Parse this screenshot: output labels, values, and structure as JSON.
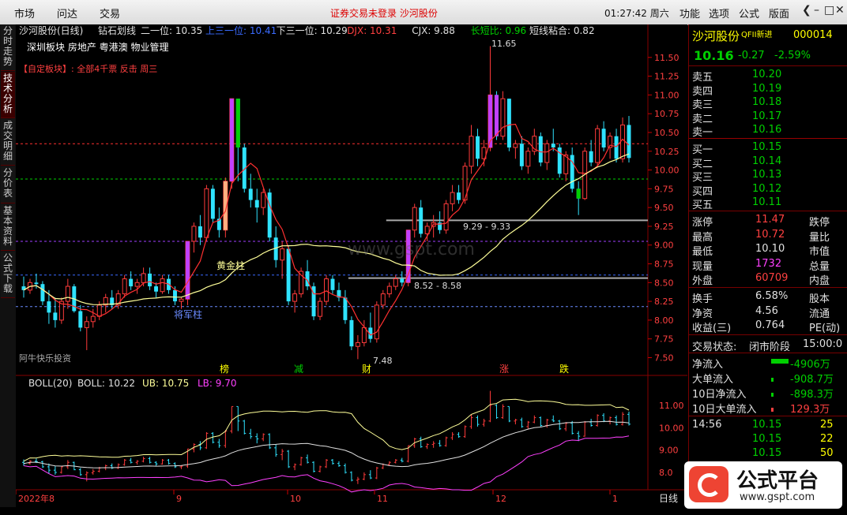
{
  "topbar": {
    "menus": [
      "市场",
      "问达",
      "交易"
    ],
    "notice": "证券交易未登录  沙河股份",
    "clock": "01:27:42 周六",
    "tools": [
      "功能",
      "选项",
      "公式",
      "版面"
    ],
    "win": [
      "❮",
      "–",
      "□",
      "✕"
    ]
  },
  "lefttabs": [
    "分时走势",
    "技术分析",
    "成交明细",
    "分价表",
    "基本资料",
    "公式下载"
  ],
  "chart": {
    "title": "沙河股份(日线)",
    "indicator": "钻石划线",
    "lines": [
      {
        "label": "二一位: 10.35",
        "color": "#e0e0e0"
      },
      {
        "label": "上三一位: 10.41",
        "color": "#3a6bff"
      },
      {
        "label": "下三一位: 10.29",
        "color": "#e0e0e0"
      },
      {
        "label": "DJX: 10.31",
        "color": "#ff4040"
      },
      {
        "label": "CJX: 9.88",
        "color": "#e0e0e0"
      },
      {
        "label": "长短比: 0.96",
        "color": "#00d000"
      },
      {
        "label": "短线粘合: 0.82",
        "color": "#e0e0e0"
      }
    ],
    "sector": "深圳板块 房地产 粤港澳 物业管理",
    "custom": "【自定板块】: 全部4千票 反击 周三",
    "watermark": "www.gspt.com",
    "annotations": {
      "high": "11.65",
      "low": "7.48",
      "gold": "黄金柱",
      "general": "将军柱",
      "range": "9.29 - 9.33",
      "level": "8.52 - 8.58",
      "footer": "阿牛快乐投资",
      "tags": [
        "榜",
        "减",
        "财",
        "涨",
        "跌"
      ]
    },
    "y_ticks": [
      "11.50",
      "11.25",
      "11.00",
      "10.75",
      "10.50",
      "10.25",
      "10.00",
      "9.75",
      "9.50",
      "9.25",
      "9.00",
      "8.75",
      "8.50",
      "8.25",
      "8.00",
      "7.75",
      "7.50"
    ],
    "boll": {
      "title": "BOLL(20)",
      "mid": "BOLL: 10.22",
      "ub": "UB: 10.75",
      "lb": "LB: 9.70",
      "y_ticks": [
        "11.00",
        "10.00",
        "9.00",
        "8.0"
      ]
    },
    "x_labels": [
      "2022年8",
      "9",
      "10",
      "11",
      "12",
      "1"
    ],
    "period": "日线"
  },
  "quote": {
    "name": "沙河股份",
    "badge": "QFII新进",
    "code": "000014",
    "price": "10.16",
    "change": "-0.27",
    "pct": "-2.59%",
    "asks": [
      {
        "label": "卖五",
        "price": "10.20"
      },
      {
        "label": "卖四",
        "price": "10.19"
      },
      {
        "label": "卖三",
        "price": "10.18"
      },
      {
        "label": "卖二",
        "price": "10.17"
      },
      {
        "label": "卖一",
        "price": "10.16"
      }
    ],
    "bids": [
      {
        "label": "买一",
        "price": "10.15"
      },
      {
        "label": "买二",
        "price": "10.14"
      },
      {
        "label": "买三",
        "price": "10.13"
      },
      {
        "label": "买四",
        "price": "10.12"
      },
      {
        "label": "买五",
        "price": "10.11"
      }
    ],
    "stats": [
      {
        "l1": "涨停",
        "v1": "11.47",
        "c1": "#ff4040",
        "l2": "跌停"
      },
      {
        "l1": "最高",
        "v1": "10.72",
        "c1": "#ff4040",
        "l2": "量比"
      },
      {
        "l1": "最低",
        "v1": "10.10",
        "c1": "#e0e0e0",
        "l2": "市值"
      },
      {
        "l1": "现量",
        "v1": "1732",
        "c1": "#ff40ff",
        "l2": "总量"
      },
      {
        "l1": "外盘",
        "v1": "60709",
        "c1": "#ff4040",
        "l2": "内盘"
      }
    ],
    "stats2": [
      {
        "l1": "换手",
        "v1": "6.58%",
        "l2": "股本"
      },
      {
        "l1": "净资",
        "v1": "4.56",
        "l2": "流通"
      },
      {
        "l1": "收益(三)",
        "v1": "0.764",
        "l2": "PE(动)"
      }
    ],
    "status_label": "交易状态:",
    "status_value": "闭市阶段",
    "status_time": "15:00:0",
    "flows": [
      {
        "label": "净流入",
        "value": "-4906万"
      },
      {
        "label": "大单流入",
        "value": "-908.7万"
      },
      {
        "label": "10日净流入",
        "value": "-898.3万"
      },
      {
        "label": "10日大单流入",
        "value": "129.3万"
      }
    ],
    "ticks": [
      {
        "time": "14:56",
        "price": "10.15",
        "vol": "25"
      },
      {
        "time": "",
        "price": "10.15",
        "vol": "22"
      },
      {
        "time": "",
        "price": "10.15",
        "vol": "50"
      },
      {
        "time": "",
        "price": "10.15",
        "vol": "46"
      }
    ]
  },
  "logo": {
    "text": "公式平台",
    "url": "www.gspt.com"
  },
  "chart_data": {
    "type": "candlestick",
    "y_range": [
      7.4,
      11.75
    ],
    "ohlc": [
      [
        8.45,
        8.58,
        8.3,
        8.4
      ],
      [
        8.4,
        8.55,
        8.35,
        8.5
      ],
      [
        8.5,
        8.62,
        8.42,
        8.48
      ],
      [
        8.48,
        8.52,
        8.2,
        8.25
      ],
      [
        8.25,
        8.4,
        7.95,
        8.1
      ],
      [
        8.1,
        8.3,
        7.9,
        8.0
      ],
      [
        8.0,
        8.3,
        7.95,
        8.25
      ],
      [
        8.25,
        8.55,
        8.15,
        8.45
      ],
      [
        8.45,
        8.48,
        8.1,
        8.12
      ],
      [
        8.12,
        8.2,
        7.85,
        7.9
      ],
      [
        7.9,
        8.05,
        7.6,
        7.98
      ],
      [
        7.98,
        8.15,
        7.9,
        8.05
      ],
      [
        8.05,
        8.25,
        8.0,
        8.2
      ],
      [
        8.2,
        8.35,
        8.1,
        8.3
      ],
      [
        8.3,
        8.4,
        8.15,
        8.2
      ],
      [
        8.2,
        8.4,
        8.15,
        8.35
      ],
      [
        8.35,
        8.6,
        8.3,
        8.55
      ],
      [
        8.55,
        8.65,
        8.4,
        8.45
      ],
      [
        8.45,
        8.55,
        8.35,
        8.5
      ],
      [
        8.5,
        8.7,
        8.45,
        8.62
      ],
      [
        8.62,
        8.7,
        8.4,
        8.45
      ],
      [
        8.45,
        8.5,
        8.3,
        8.38
      ],
      [
        8.38,
        8.6,
        8.35,
        8.55
      ],
      [
        8.55,
        8.6,
        8.35,
        8.4
      ],
      [
        8.4,
        8.45,
        8.2,
        8.25
      ],
      [
        8.25,
        8.3,
        8.15,
        8.28
      ],
      [
        8.28,
        9.05,
        8.2,
        9.05
      ],
      [
        9.05,
        9.3,
        8.9,
        9.25
      ],
      [
        9.25,
        9.4,
        9.0,
        9.1
      ],
      [
        9.1,
        9.8,
        9.05,
        9.75
      ],
      [
        9.75,
        9.8,
        9.3,
        9.35
      ],
      [
        9.35,
        9.5,
        9.1,
        9.2
      ],
      [
        9.2,
        9.9,
        9.1,
        9.85
      ],
      [
        9.85,
        10.95,
        9.75,
        10.95
      ],
      [
        10.95,
        10.95,
        9.85,
        10.3
      ],
      [
        10.3,
        10.35,
        9.7,
        9.75
      ],
      [
        9.75,
        9.95,
        9.5,
        9.6
      ],
      [
        9.6,
        9.75,
        9.3,
        9.5
      ],
      [
        9.5,
        9.75,
        9.4,
        9.7
      ],
      [
        9.7,
        9.75,
        9.05,
        9.1
      ],
      [
        9.1,
        9.25,
        8.7,
        8.8
      ],
      [
        8.8,
        9.05,
        8.55,
        8.95
      ],
      [
        8.95,
        9.0,
        8.2,
        8.25
      ],
      [
        8.25,
        8.4,
        8.1,
        8.35
      ],
      [
        8.35,
        8.7,
        8.3,
        8.65
      ],
      [
        8.65,
        8.8,
        8.4,
        8.45
      ],
      [
        8.45,
        8.5,
        8.0,
        8.05
      ],
      [
        8.05,
        8.3,
        8.0,
        8.25
      ],
      [
        8.25,
        8.6,
        8.2,
        8.55
      ],
      [
        8.55,
        8.6,
        8.35,
        8.4
      ],
      [
        8.4,
        8.5,
        8.25,
        8.3
      ],
      [
        8.3,
        8.4,
        7.95,
        8.0
      ],
      [
        8.0,
        8.05,
        7.6,
        7.65
      ],
      [
        7.65,
        7.8,
        7.48,
        7.7
      ],
      [
        7.7,
        8.0,
        7.65,
        7.9
      ],
      [
        7.9,
        8.1,
        7.7,
        7.75
      ],
      [
        7.75,
        8.25,
        7.7,
        8.2
      ],
      [
        8.2,
        8.4,
        8.15,
        8.35
      ],
      [
        8.35,
        8.5,
        8.3,
        8.45
      ],
      [
        8.45,
        8.6,
        8.4,
        8.55
      ],
      [
        8.55,
        8.65,
        8.45,
        8.5
      ],
      [
        8.5,
        9.2,
        8.45,
        9.2
      ],
      [
        9.2,
        9.55,
        9.1,
        9.5
      ],
      [
        9.5,
        9.6,
        9.1,
        9.15
      ],
      [
        9.15,
        9.3,
        9.05,
        9.25
      ],
      [
        9.25,
        9.4,
        9.1,
        9.3
      ],
      [
        9.3,
        9.45,
        9.15,
        9.2
      ],
      [
        9.2,
        9.6,
        9.15,
        9.55
      ],
      [
        9.55,
        9.8,
        9.45,
        9.7
      ],
      [
        9.7,
        9.8,
        9.55,
        9.6
      ],
      [
        9.6,
        10.1,
        9.55,
        10.05
      ],
      [
        10.05,
        10.6,
        9.95,
        10.45
      ],
      [
        10.45,
        10.55,
        10.05,
        10.15
      ],
      [
        10.15,
        10.4,
        10.05,
        10.3
      ],
      [
        10.3,
        11.65,
        10.25,
        11.0
      ],
      [
        11.0,
        11.05,
        10.4,
        10.45
      ],
      [
        10.45,
        11.05,
        10.4,
        10.95
      ],
      [
        10.95,
        10.95,
        10.25,
        10.3
      ],
      [
        10.3,
        10.4,
        10.15,
        10.35
      ],
      [
        10.35,
        10.45,
        10.0,
        10.05
      ],
      [
        10.05,
        10.3,
        9.95,
        10.25
      ],
      [
        10.25,
        10.55,
        10.2,
        10.45
      ],
      [
        10.45,
        10.5,
        10.05,
        10.1
      ],
      [
        10.1,
        10.4,
        10.0,
        10.35
      ],
      [
        10.35,
        10.55,
        10.25,
        10.3
      ],
      [
        10.3,
        10.35,
        9.9,
        9.95
      ],
      [
        9.95,
        10.25,
        9.85,
        10.2
      ],
      [
        10.2,
        10.3,
        9.7,
        9.75
      ],
      [
        9.75,
        9.85,
        9.4,
        9.62
      ],
      [
        9.62,
        10.3,
        9.6,
        10.25
      ],
      [
        10.25,
        10.4,
        10.05,
        10.1
      ],
      [
        10.1,
        10.6,
        10.05,
        10.55
      ],
      [
        10.55,
        10.65,
        10.25,
        10.3
      ],
      [
        10.3,
        10.5,
        10.15,
        10.45
      ],
      [
        10.45,
        10.55,
        10.1,
        10.15
      ],
      [
        10.15,
        10.7,
        10.1,
        10.6
      ],
      [
        10.6,
        10.72,
        10.1,
        10.16
      ]
    ]
  }
}
